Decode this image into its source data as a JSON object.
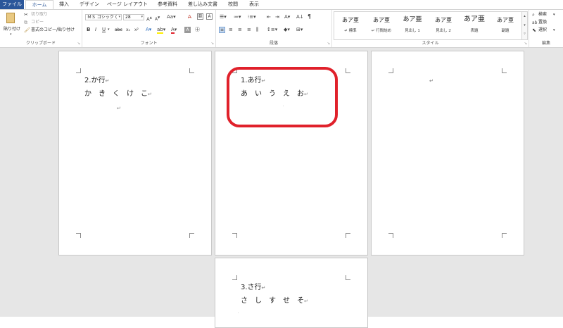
{
  "tabs": [
    "ファイル",
    "ホーム",
    "挿入",
    "デザイン",
    "ページ レイアウト",
    "参考資料",
    "差し込み文書",
    "校閲",
    "表示"
  ],
  "clipboard": {
    "paste_label": "貼り付け",
    "cut_label": "切り取り",
    "copy_label": "コピー",
    "format_painter_label": "書式のコピー/貼り付け",
    "group_label": "クリップボード"
  },
  "font": {
    "name": "ＭＳ ゴシック (",
    "size": "28",
    "group_label": "フォント"
  },
  "paragraph": {
    "group_label": "段落"
  },
  "styles": {
    "items": [
      {
        "preview": "あア亜",
        "name": "↵ 標準"
      },
      {
        "preview": "あア亜",
        "name": "↵ 行間詰め"
      },
      {
        "preview": "あア亜",
        "name": "見出し 1"
      },
      {
        "preview": "あア亜",
        "name": "見出し 2"
      },
      {
        "preview": "あア亜",
        "name": "表題"
      },
      {
        "preview": "あア亜",
        "name": "副題"
      }
    ],
    "group_label": "スタイル"
  },
  "editing": {
    "find_label": "検索",
    "replace_label": "置換",
    "select_label": "選択",
    "group_label": "編集"
  },
  "pages": {
    "page1": {
      "heading": "2.か行",
      "body": "か　き　く　け　こ"
    },
    "page2": {
      "heading": "1.あ行",
      "body": "あ　い　う　え　お"
    },
    "page3": {
      "heading": "",
      "body": ""
    },
    "page4": {
      "heading": "3.さ行",
      "body": "さ　し　す　せ　そ"
    }
  },
  "colors": {
    "file_tab": "#2b579a",
    "highlight_border": "#e0212b",
    "doc_background": "#e6e6e6"
  }
}
